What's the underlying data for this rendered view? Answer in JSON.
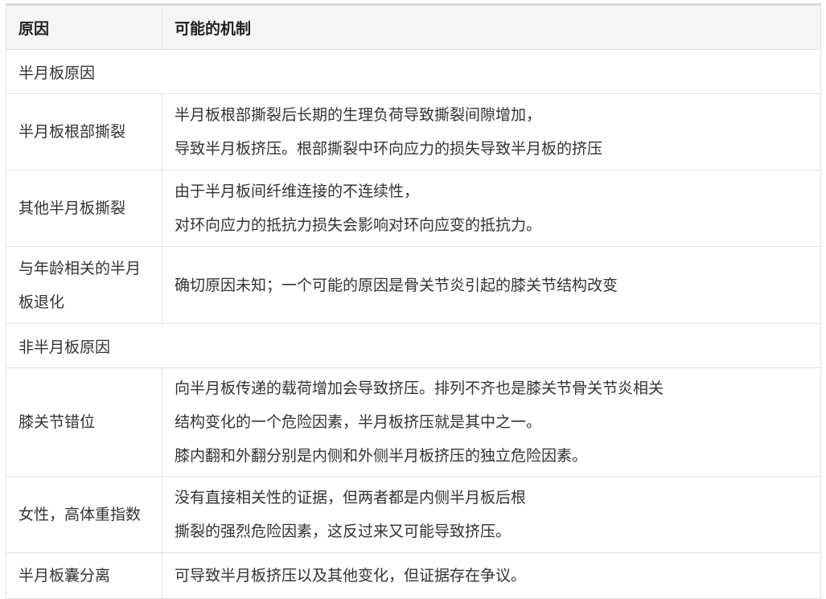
{
  "table": {
    "headers": [
      "原因",
      "可能的机制"
    ],
    "rows": [
      {
        "type": "section",
        "label": "半月板原因"
      },
      {
        "type": "row",
        "cause": "半月板根部撕裂",
        "mechanism": [
          "半月板根部撕裂后长期的生理负荷导致撕裂间隙增加，",
          "导致半月板挤压。根部撕裂中环向应力的损失导致半月板的挤压"
        ]
      },
      {
        "type": "row",
        "cause": "其他半月板撕裂",
        "mechanism": [
          "由于半月板间纤维连接的不连续性，",
          "对环向应力的抵抗力损失会影响对环向应变的抵抗力。"
        ]
      },
      {
        "type": "row",
        "cause": "与年龄相关的半月板退化",
        "mechanism": [
          "确切原因未知；一个可能的原因是骨关节炎引起的膝关节结构改变"
        ]
      },
      {
        "type": "section",
        "label": "非半月板原因"
      },
      {
        "type": "row",
        "cause": "膝关节错位",
        "mechanism": [
          "向半月板传递的载荷增加会导致挤压。排列不齐也是膝关节骨关节炎相关",
          "结构变化的一个危险因素，半月板挤压就是其中之一。",
          "膝内翻和外翻分别是内侧和外侧半月板挤压的独立危险因素。"
        ]
      },
      {
        "type": "row",
        "cause": "女性，高体重指数",
        "mechanism": [
          "没有直接相关性的证据，但两者都是内侧半月板后根",
          "撕裂的强烈危险因素，这反过来又可能导致挤压。"
        ]
      },
      {
        "type": "row",
        "cause": "半月板囊分离",
        "mechanism": [
          "可导致半月板挤压以及其他变化，但证据存在争议。"
        ]
      }
    ]
  }
}
